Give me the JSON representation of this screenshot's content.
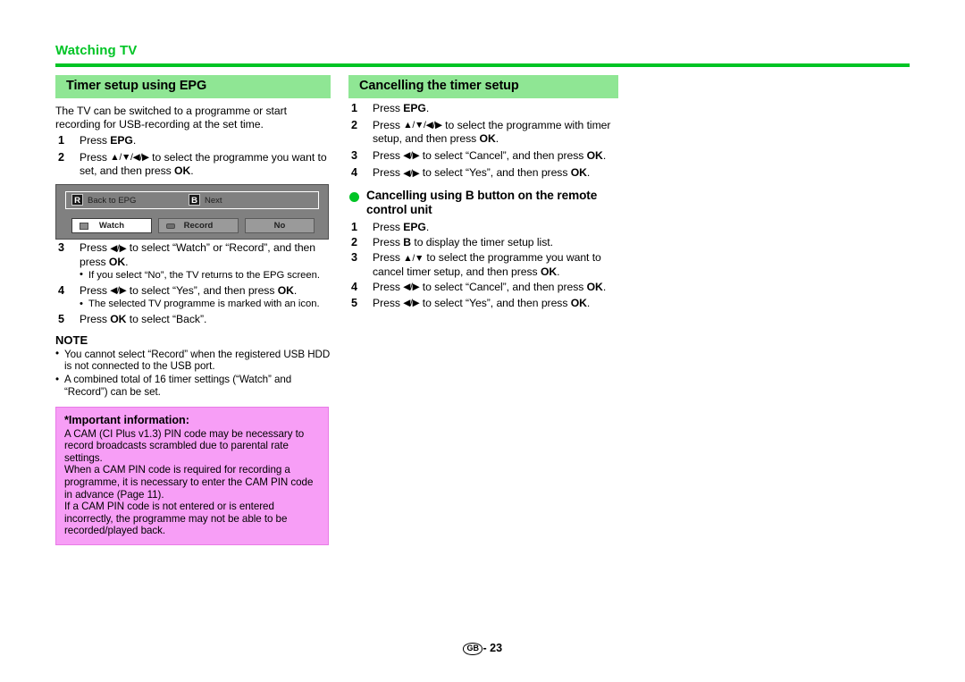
{
  "page": {
    "running_head": "Watching TV",
    "footer_region": "GB",
    "footer_separator": "-",
    "footer_page_number": "23",
    "accent_green": "#00c425",
    "header_bar_green": "#8fe694",
    "important_pink": "#f79ef6"
  },
  "left_column": {
    "section_title": "Timer setup using EPG",
    "intro": "The TV can be switched to a programme or start recording for USB-recording at the set time.",
    "steps_top": [
      {
        "num": "1",
        "text": "Press ",
        "bold": "EPG",
        "after": "."
      },
      {
        "num": "2",
        "text_pre": "Press ",
        "keys": "▲/▼/◀/▶",
        "text_mid": " to select the programme you want to set, and then press ",
        "bold": "OK",
        "after": "."
      }
    ],
    "osd_figure": {
      "key_r": "R",
      "key_r_label": "Back to EPG",
      "key_b": "B",
      "key_b_label": "Next",
      "button_watch": "Watch",
      "button_record": "Record",
      "button_no": "No",
      "watch_icon": "tv-icon",
      "record_icon": "usb-icon"
    },
    "steps_bottom": [
      {
        "num": "3",
        "text_pre": "Press ",
        "keys": "◀/▶",
        "text_mid": " to select “Watch” or “Record”, and then press ",
        "bold": "OK",
        "after": ".",
        "sub": "If you select “No”, the TV returns to the EPG screen."
      },
      {
        "num": "4",
        "text_pre": "Press ",
        "keys": "◀/▶",
        "text_mid": " to select “Yes”, and then press ",
        "bold": "OK",
        "after": ".",
        "sub": "The selected TV programme is marked with an icon."
      },
      {
        "num": "5",
        "text_pre": "Press ",
        "bold": "OK",
        "text_mid": " to select “Back”.",
        "after": ""
      }
    ],
    "note_title": "NOTE",
    "notes": [
      "You cannot select “Record” when the registered USB HDD is not connected to the USB port.",
      "A combined total of 16 timer settings (“Watch” and “Record”) can be set."
    ],
    "important": {
      "title": "*Important information:",
      "paragraphs": [
        "A CAM (CI Plus v1.3) PIN code may be necessary to record broadcasts scrambled due to parental rate settings.",
        "When a CAM PIN code is required for recording a programme, it is necessary to enter the CAM PIN code in advance (Page 11).",
        "If a CAM PIN code is not entered or is entered incorrectly, the programme may not be able to be recorded/played back."
      ]
    }
  },
  "right_column": {
    "section_title": "Cancelling the timer setup",
    "steps_top": [
      {
        "num": "1",
        "text_pre": "Press ",
        "bold": "EPG",
        "text_mid": ".",
        "after": ""
      },
      {
        "num": "2",
        "text_pre": "Press ",
        "keys": "▲/▼/◀/▶",
        "text_mid": " to select the programme with timer setup, and then press ",
        "bold": "OK",
        "after": "."
      },
      {
        "num": "3",
        "text_pre": "Press ",
        "keys": "◀/▶",
        "text_mid": " to select “Cancel”, and then press ",
        "bold": "OK",
        "after": "."
      },
      {
        "num": "4",
        "text_pre": "Press ",
        "keys": "◀/▶",
        "text_mid": " to select “Yes”, and then press ",
        "bold": "OK",
        "after": "."
      }
    ],
    "bullet_heading": "Cancelling using B button on the remote control unit",
    "steps_bottom": [
      {
        "num": "1",
        "text_pre": "Press ",
        "bold": "EPG",
        "text_mid": ".",
        "after": ""
      },
      {
        "num": "2",
        "text_pre": "Press ",
        "bold": "B",
        "text_mid": " to display the timer setup list.",
        "after": ""
      },
      {
        "num": "3",
        "text_pre": "Press ",
        "keys": "▲/▼",
        "text_mid": " to select the programme you want to cancel timer setup, and then press ",
        "bold": "OK",
        "after": "."
      },
      {
        "num": "4",
        "text_pre": "Press ",
        "keys": "◀/▶",
        "text_mid": " to select “Cancel”, and then press ",
        "bold": "OK",
        "after": "."
      },
      {
        "num": "5",
        "text_pre": "Press ",
        "keys": "◀/▶",
        "text_mid": " to select “Yes”, and then press ",
        "bold": "OK",
        "after": "."
      }
    ]
  }
}
